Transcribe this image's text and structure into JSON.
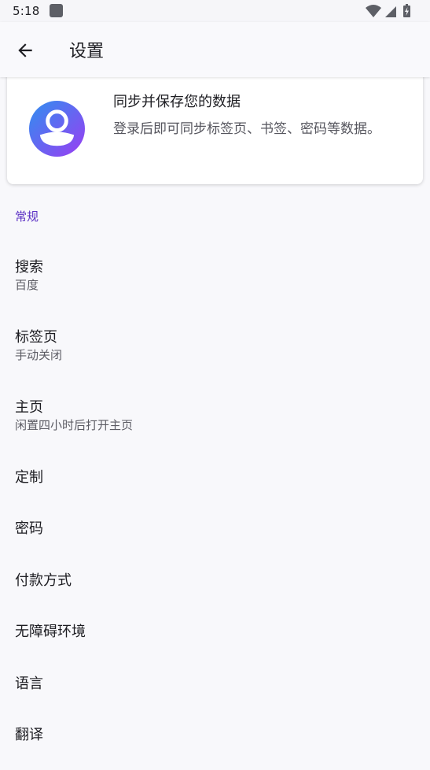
{
  "status_bar": {
    "time": "5:18",
    "icons": [
      "app-notification-icon",
      "wifi-icon",
      "signal-icon",
      "battery-charging-icon"
    ]
  },
  "app_bar": {
    "back_icon": "arrow-left-icon",
    "title": "设置"
  },
  "account_card": {
    "avatar_icon": "account-avatar-icon",
    "title": "同步并保存您的数据",
    "description": "登录后即可同步标签页、书签、密码等数据。",
    "colors": {
      "gradient_start": "#2f8ff0",
      "gradient_end": "#9b3df2"
    }
  },
  "section": {
    "header": "常规",
    "header_color": "#5a2fc4"
  },
  "items": [
    {
      "title": "搜索",
      "subtitle": "百度"
    },
    {
      "title": "标签页",
      "subtitle": "手动关闭"
    },
    {
      "title": "主页",
      "subtitle": "闲置四小时后打开主页"
    },
    {
      "title": "定制"
    },
    {
      "title": "密码"
    },
    {
      "title": "付款方式"
    },
    {
      "title": "无障碍环境"
    },
    {
      "title": "语言"
    },
    {
      "title": "翻译"
    }
  ]
}
